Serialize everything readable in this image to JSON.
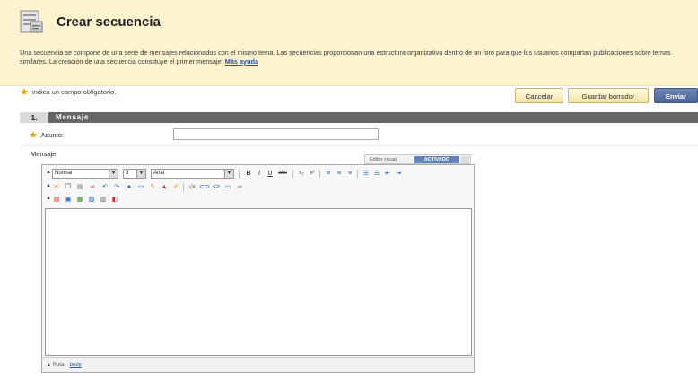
{
  "page": {
    "title": "Crear secuencia",
    "description": "Una secuencia se compone de una serie de mensajes relacionados con el mismo tema. Las secuencias proporcionan una estructura organizativa dentro de un foro para que los usuarios compartan publicaciones sobre temas similares. La creación de una secuencia constituye el primer mensaje.",
    "help_link": "Más ayuda",
    "required_note": "indica un campo obligatorio."
  },
  "buttons": {
    "cancel": "Cancelar",
    "save_draft": "Guardar borrador",
    "send": "Enviar"
  },
  "section": {
    "number": "1.",
    "title": "Mensaje"
  },
  "form": {
    "subject_label": "Asunto:",
    "subject_value": "",
    "message_label": "Mensaje"
  },
  "editor": {
    "visual_editor_label": "Editor visual:",
    "visual_editor_state": "ACTIVADO",
    "format_value": "Normal",
    "size_value": "3",
    "font_value": "Arial",
    "path_label": "Ruta:",
    "path_value": "body"
  },
  "colors": {
    "header_bg": "#fdf3cf",
    "accent": "#4a6698",
    "section_bar": "#666666",
    "required": "#e0a000"
  }
}
